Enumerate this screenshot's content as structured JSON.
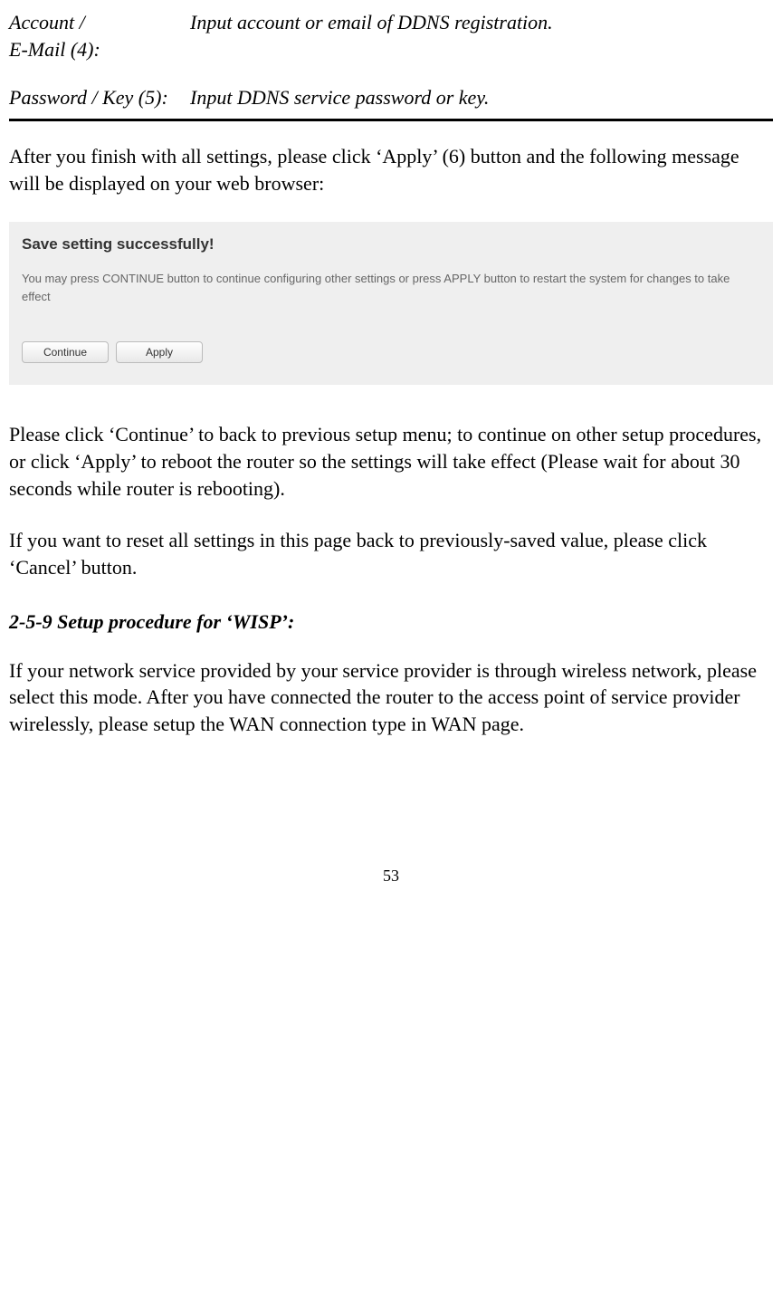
{
  "definitions": {
    "account": {
      "term_line1": "Account /",
      "term_line2": "E-Mail (4):",
      "desc": "Input account or email of DDNS registration."
    },
    "password": {
      "term": "Password / Key (5):",
      "desc": "Input DDNS service password or key."
    }
  },
  "paragraphs": {
    "p1": "After you finish with all settings, please click ‘Apply’ (6) button and the following message will be displayed on your web browser:",
    "p2": "Please click ‘Continue’ to back to previous setup menu; to continue on other setup procedures, or click ‘Apply’ to reboot the router so the settings will take effect (Please wait for about 30 seconds while router is rebooting).",
    "p3": "If you want to reset all settings in this page back to previously-saved value, please click ‘Cancel’ button.",
    "p4": "If your network service provided by your service provider is through wireless network, please select this mode. After you have connected the router to the access point of service provider wirelessly, please setup the WAN connection type in WAN page."
  },
  "screenshot": {
    "title": "Save setting successfully!",
    "text": "You may press CONTINUE button to continue configuring other settings or press APPLY button to restart the system for changes to take effect",
    "continue_label": "Continue",
    "apply_label": "Apply"
  },
  "section_heading": "2-5-9 Setup procedure for ‘WISP’:",
  "page_number": "53"
}
